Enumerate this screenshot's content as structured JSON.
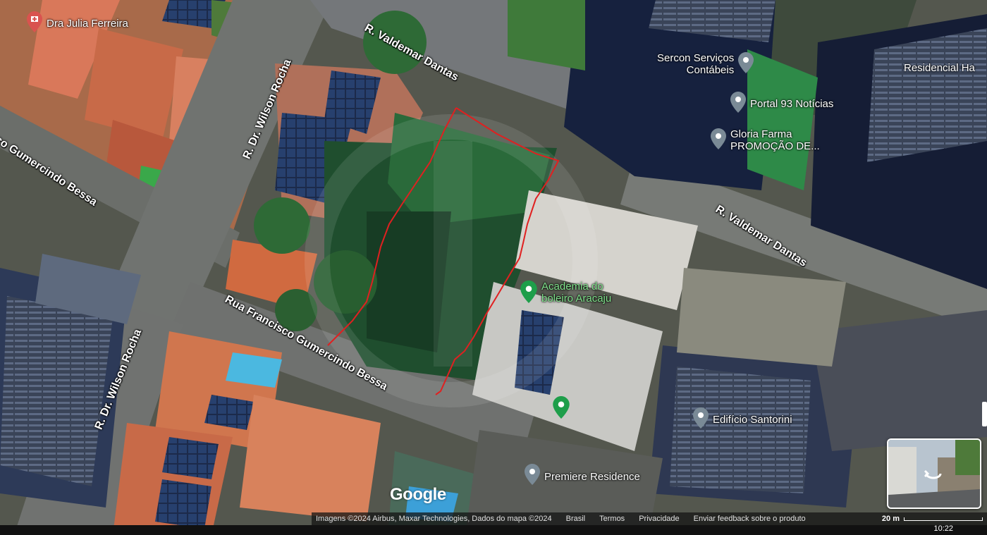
{
  "streets": {
    "valdemar_1": "R. Valdemar Dantas",
    "valdemar_2": "R. Valdemar Dantas",
    "wilson_1": "R. Dr. Wilson Rocha",
    "wilson_2": "R. Dr. Wilson Rocha",
    "gumercindo_1": "co Gumercindo Bessa",
    "gumercindo_2": "Rua Francisco Gumercindo Bessa"
  },
  "places": {
    "julia": "Dra Julia Ferreira",
    "sercon_line1": "Sercon Serviços",
    "sercon_line2": "Contábeis",
    "portal": "Portal 93 Notícias",
    "gloria_line1": "Gloria Farma",
    "gloria_line2": "PROMOÇÃO DE...",
    "residencial": "Residencial Ha",
    "academia_line1": "Academia do",
    "academia_line2": "boleiro Aracaju",
    "santorini": "Edifício Santorini",
    "premiere": "Premiere Residence"
  },
  "logo": "Google",
  "attribution": {
    "imagery": "Imagens ©2024 Airbus, Maxar Technologies, Dados do mapa ©2024",
    "country": "Brasil",
    "terms": "Termos",
    "privacy": "Privacidade",
    "feedback": "Enviar feedback sobre o produto",
    "scale": "20 m"
  },
  "clock": "10:22",
  "colors": {
    "parcel_outline": "#e02020",
    "poi_pin": "#7a8a96",
    "poi_pin_green": "#1e9e4a",
    "poi_pin_red": "#d9534f"
  }
}
